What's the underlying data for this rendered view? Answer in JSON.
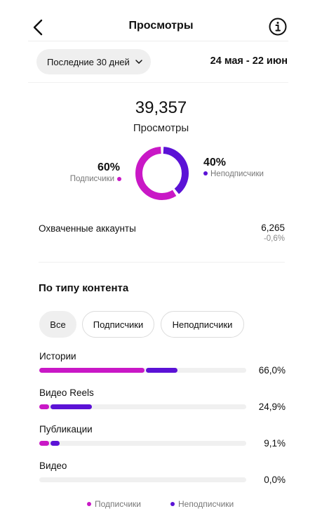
{
  "header": {
    "title": "Просмотры"
  },
  "period": {
    "label": "Последние 30 дней",
    "range": "24 мая - 22 июн"
  },
  "summary": {
    "total": "39,357",
    "total_label": "Просмотры",
    "followers_pct": "60%",
    "followers_label": "Подписчики",
    "non_followers_pct": "40%",
    "non_followers_label": "Неподписчики",
    "followers_share": 0.6,
    "non_followers_share": 0.4
  },
  "reach": {
    "label": "Охваченные аккаунты",
    "value": "6,265",
    "change": "-0,6%"
  },
  "content_type": {
    "title": "По типу контента",
    "filters": [
      "Все",
      "Подписчики",
      "Неподписчики"
    ],
    "rows": [
      {
        "label": "Истории",
        "percent": "66,0%",
        "followers_share": 0.509,
        "non_followers_share": 0.151
      },
      {
        "label": "Видео Reels",
        "percent": "24,9%",
        "followers_share": 0.047,
        "non_followers_share": 0.202
      },
      {
        "label": "Публикации",
        "percent": "9,1%",
        "followers_share": 0.047,
        "non_followers_share": 0.044
      },
      {
        "label": "Видео",
        "percent": "0,0%",
        "followers_share": 0,
        "non_followers_share": 0
      }
    ]
  },
  "legend": {
    "followers": "Подписчики",
    "non_followers": "Неподписчики"
  },
  "colors": {
    "followers": "#c918c6",
    "non_followers": "#5b12d6",
    "track": "#f0f0f0"
  }
}
